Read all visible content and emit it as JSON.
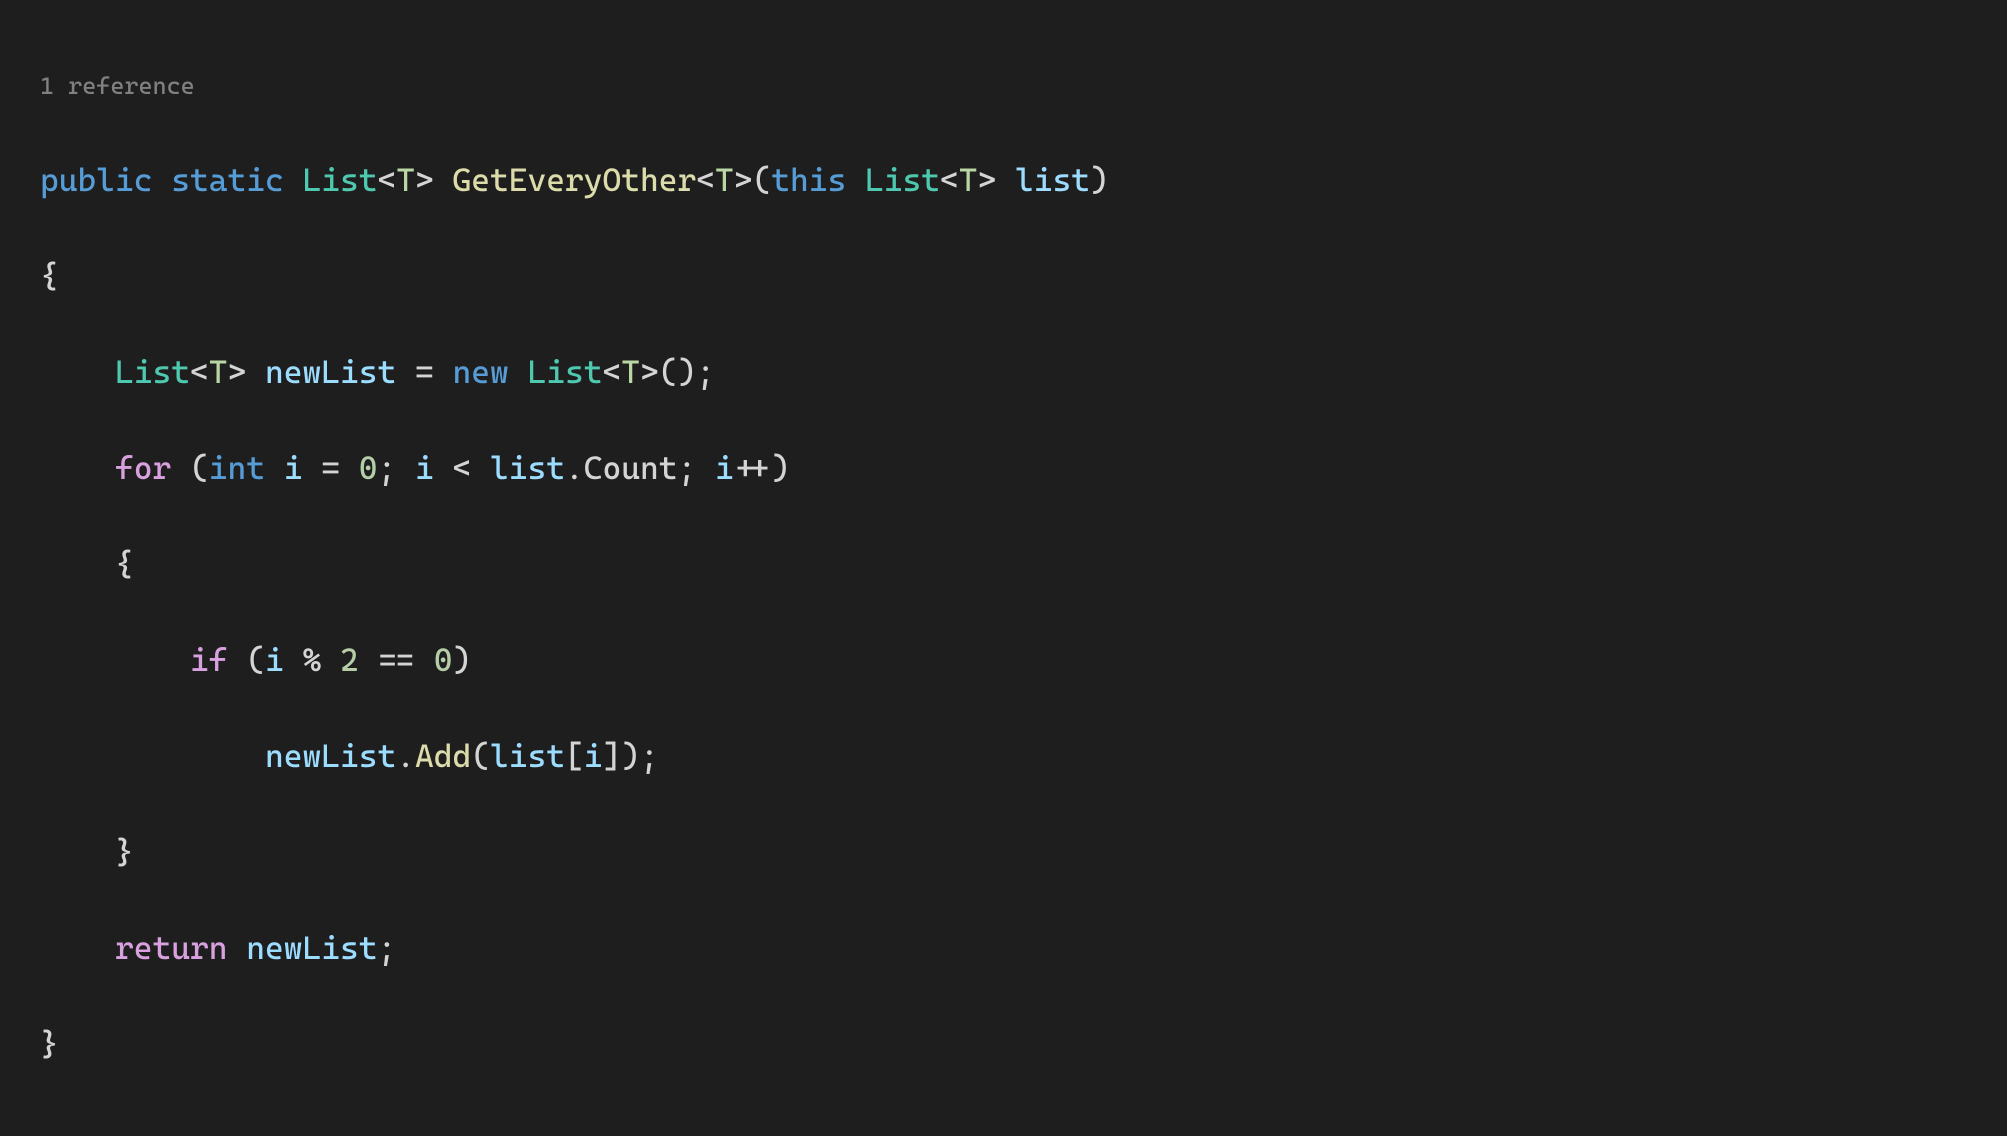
{
  "codelens": {
    "references": "1 reference"
  },
  "code": {
    "keywords": {
      "public": "public",
      "static": "static",
      "this": "this",
      "new": "new",
      "int": "int",
      "for": "for",
      "if": "if",
      "return": "return"
    },
    "types": {
      "List": "List",
      "T": "T"
    },
    "methods": {
      "GetEveryOther": "GetEveryOther",
      "Add": "Add"
    },
    "members": {
      "Count": "Count"
    },
    "variables": {
      "list": "list",
      "newList": "newList",
      "i": "i"
    },
    "numbers": {
      "zero": "0",
      "two": "2"
    },
    "punct": {
      "open_angle": "<",
      "close_angle": ">",
      "open_paren": "(",
      "close_paren": ")",
      "open_brace": "{",
      "close_brace": "}",
      "open_bracket": "[",
      "close_bracket": "]",
      "semicolon": ";",
      "dot": ".",
      "equals": "=",
      "eq_eq": "==",
      "lt": "<",
      "mod": "%",
      "plusplus": "++"
    }
  }
}
